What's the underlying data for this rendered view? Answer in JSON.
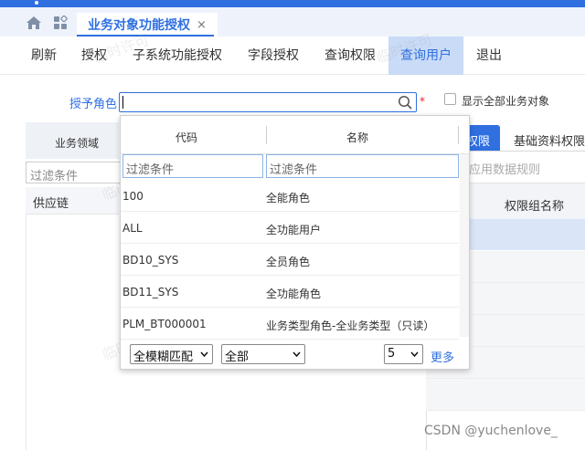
{
  "tabs": {
    "active_label": "业务对象功能授权",
    "close_glyph": "×"
  },
  "toolbar": {
    "buttons": [
      "刷新",
      "授权",
      "子系统功能授权",
      "字段授权",
      "查询权限",
      "查询用户",
      "退出"
    ],
    "active_index": 5
  },
  "role_field": {
    "label": "授予角色",
    "value": "",
    "required_mark": "*"
  },
  "show_all_checkbox": {
    "label": "显示全部业务对象",
    "checked": false
  },
  "left_panel": {
    "header": "业务领域",
    "filter_placeholder": "过滤条件",
    "rows": [
      "供应链"
    ]
  },
  "right_panel": {
    "tabs": [
      "权限",
      "基础资料权限"
    ],
    "active_tab": 0,
    "rule_text": "应用数据规则",
    "grid_header": "权限组名称"
  },
  "dropdown": {
    "columns": [
      "代码",
      "名称"
    ],
    "code_filter_placeholder": "过滤条件",
    "name_filter_placeholder": "过滤条件",
    "rows": [
      {
        "code": "100",
        "name": "全能角色"
      },
      {
        "code": "ALL",
        "name": "全功能用户"
      },
      {
        "code": "BD10_SYS",
        "name": "全员角色"
      },
      {
        "code": "BD11_SYS",
        "name": "全功能角色"
      },
      {
        "code": "PLM_BT000001",
        "name": "业务类型角色-全业务类型（只读）"
      }
    ],
    "match_mode": "全模糊匹配",
    "scope": "全部",
    "page_size": "5",
    "more_label": "更多"
  },
  "watermark_text": "临时许可",
  "credit": "CSDN @yuchenlove_",
  "colors": {
    "accent": "#2f6fe0",
    "active_toolbar_bg": "#c9dbf7",
    "required": "#e23333"
  }
}
